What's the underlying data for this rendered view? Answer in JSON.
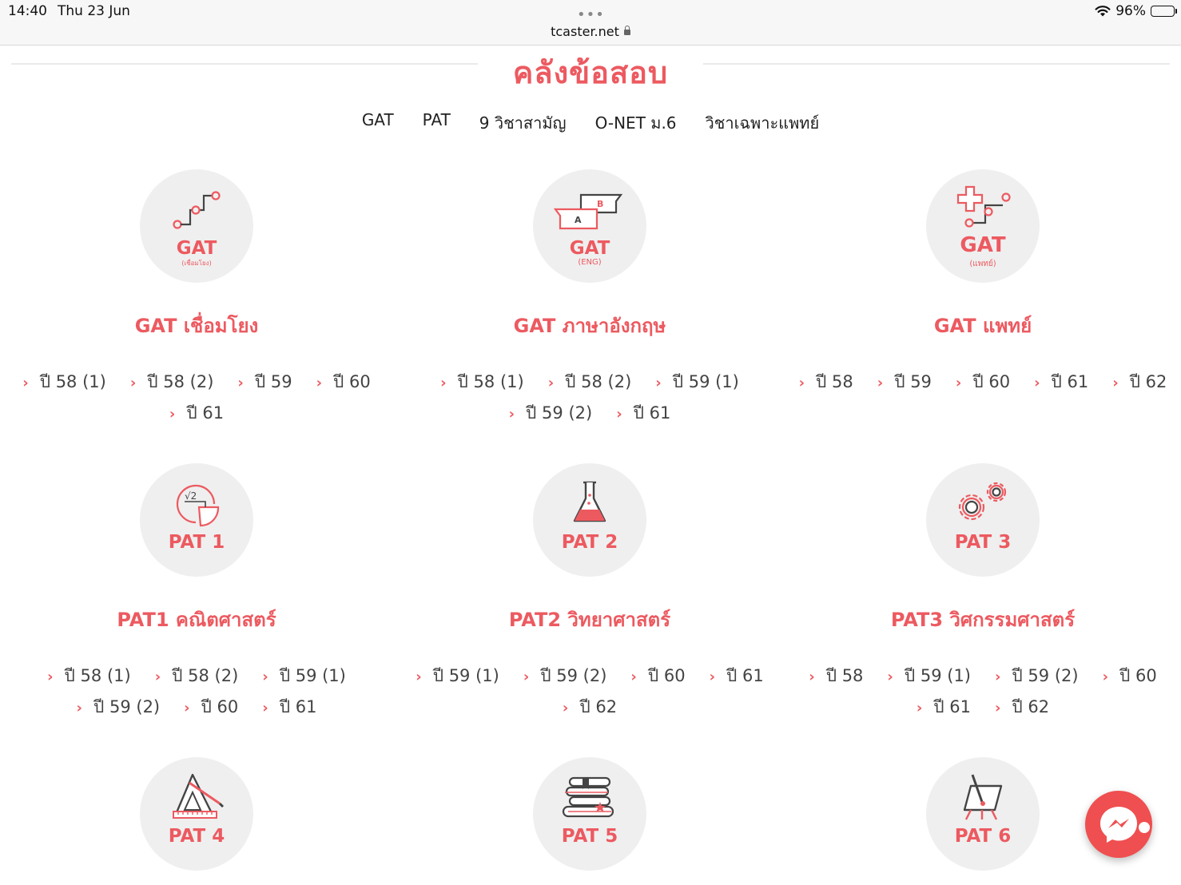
{
  "statusbar": {
    "time": "14:40",
    "date": "Thu 23 Jun",
    "dots": "•••",
    "url": "tcaster.net",
    "battery": "96%",
    "battery_level": 0.96
  },
  "page": {
    "title": "คลังข้อสอบ"
  },
  "nav": {
    "items": [
      {
        "label": "GAT"
      },
      {
        "label": "PAT"
      },
      {
        "label": "9 วิชาสามัญ"
      },
      {
        "label": "O-NET ม.6"
      },
      {
        "label": "วิชาเฉพาะแพทย์"
      }
    ]
  },
  "cards": [
    {
      "icon_label": "GAT",
      "icon_sub": "(เชื่อมโยง)",
      "title": "GAT เชื่อมโยง",
      "years": [
        "ปี 58 (1)",
        "ปี 58 (2)",
        "ปี 59",
        "ปี 60",
        "ปี 61"
      ]
    },
    {
      "icon_label": "GAT",
      "icon_sub": "(ENG)",
      "title": "GAT ภาษาอังกฤษ",
      "years": [
        "ปี 58 (1)",
        "ปี 58 (2)",
        "ปี 59 (1)",
        "ปี 59 (2)",
        "ปี 61"
      ]
    },
    {
      "icon_label": "GAT",
      "icon_sub": "(แพทย์)",
      "title": "GAT แพทย์",
      "years": [
        "ปี 58",
        "ปี 59",
        "ปี 60",
        "ปี 61",
        "ปี 62"
      ]
    },
    {
      "icon_label": "PAT 1",
      "icon_sub": "",
      "title": "PAT1 คณิตศาสตร์",
      "years": [
        "ปี 58 (1)",
        "ปี 58 (2)",
        "ปี 59 (1)",
        "ปี 59 (2)",
        "ปี 60",
        "ปี 61"
      ]
    },
    {
      "icon_label": "PAT 2",
      "icon_sub": "",
      "title": "PAT2 วิทยาศาสตร์",
      "years": [
        "ปี 59 (1)",
        "ปี 59 (2)",
        "ปี 60",
        "ปี 61",
        "ปี 62"
      ]
    },
    {
      "icon_label": "PAT 3",
      "icon_sub": "",
      "title": "PAT3 วิศกรรมศาสตร์",
      "years": [
        "ปี 58",
        "ปี 59 (1)",
        "ปี 59 (2)",
        "ปี 60",
        "ปี 61",
        "ปี 62"
      ]
    },
    {
      "icon_label": "PAT 4",
      "icon_sub": "",
      "title": "",
      "years": []
    },
    {
      "icon_label": "PAT 5",
      "icon_sub": "",
      "title": "",
      "years": []
    },
    {
      "icon_label": "PAT 6",
      "icon_sub": "",
      "title": "",
      "years": []
    }
  ],
  "icons": {
    "card_icons": [
      "connect-path-icon",
      "chat-bubbles-icon",
      "medical-path-icon",
      "math-sqrt-icon",
      "flask-icon",
      "gears-icon",
      "ruler-triangle-icon",
      "books-icon",
      "easel-icon"
    ],
    "fab": "messenger-icon"
  },
  "colors": {
    "accent": "#ec5a60",
    "circle_bg": "#efefef",
    "fab": "#ef4f50"
  }
}
